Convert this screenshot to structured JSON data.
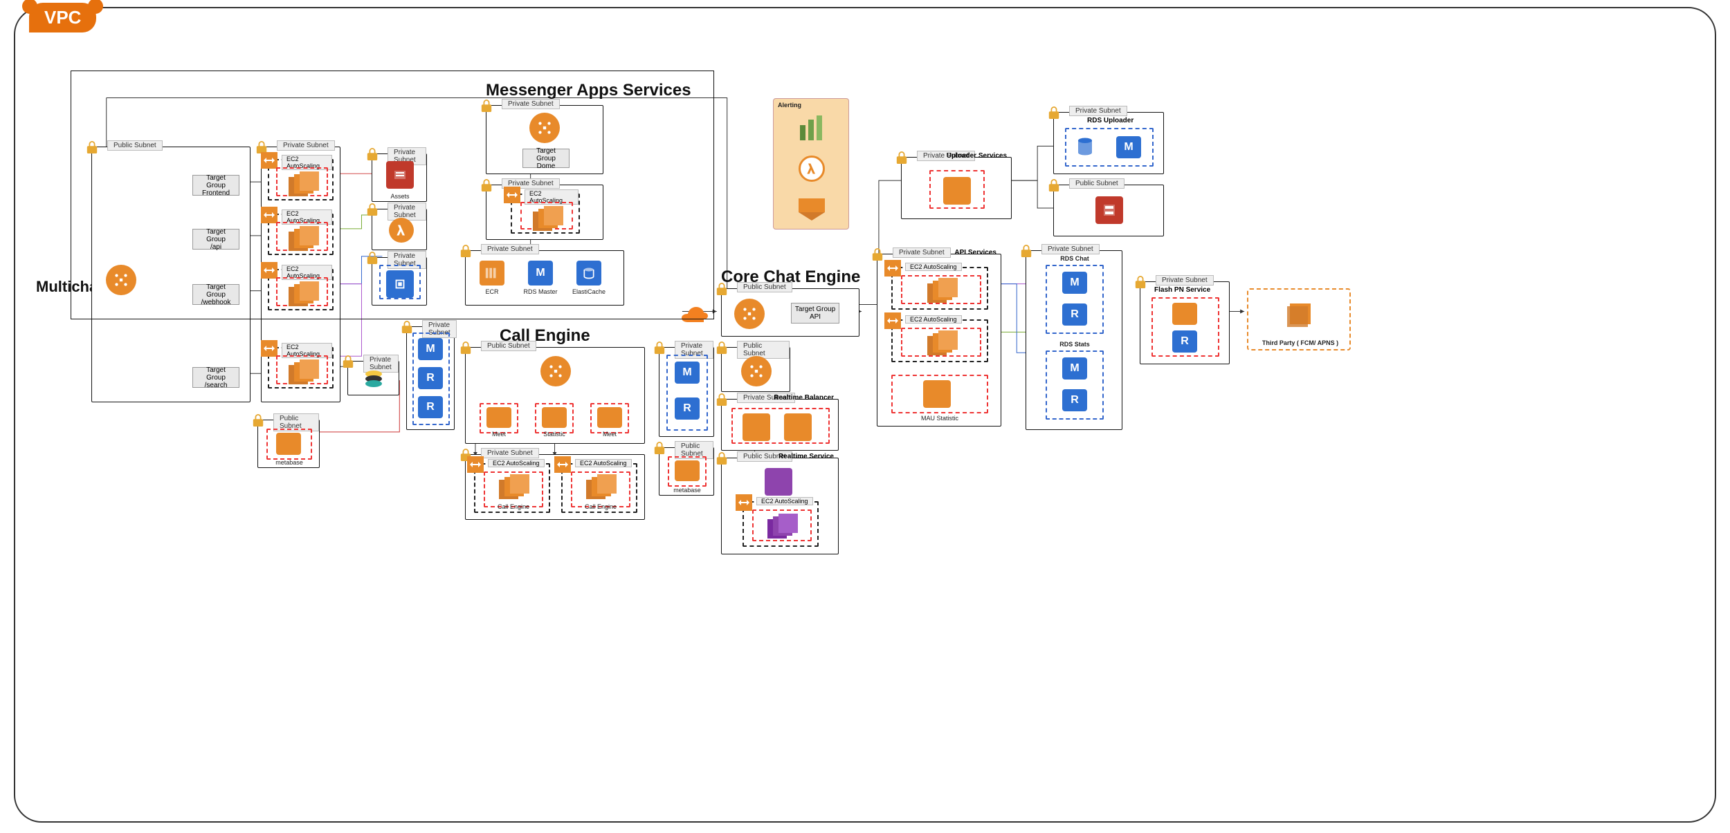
{
  "vpc_label": "VPC",
  "sections": {
    "multichannel": "Multichannel",
    "messenger": "Messenger Apps Services",
    "call_engine": "Call Engine",
    "core_chat": "Core Chat Engine"
  },
  "subnet_labels": {
    "public": "Public Subnet",
    "private": "Private Subnet"
  },
  "asg_label": "EC2 AutoScaling",
  "target_groups": {
    "frontend": "Target Group\nFrontend",
    "api": "Target Group\n/api",
    "webhook": "Target Group\n/webhook",
    "search": "Target Group\n/search",
    "dome": "Target Group\nDome",
    "core_api": "Target Group\nAPI"
  },
  "services": {
    "assets": "Assets",
    "metabase": "metabase",
    "ecr": "ECR",
    "rds_master": "RDS Master",
    "elasticache": "ElastiCache",
    "meet": "Meet",
    "statistic": "Statistic",
    "call_engine": "Call Engine",
    "realtime_balancer": "Realtime Balancer",
    "realtime_service": "Realtime Service",
    "api_services": "API Services",
    "mau_statistic": "MAU Statistic",
    "uploader_services": "Uploader Services",
    "rds_uploader": "RDS Uploader",
    "rds_chat": "RDS Chat",
    "rds_stats": "RDS Stats",
    "flash_pn": "Flash PN Service",
    "third_party": "Third Party ( FCM/ APNS )"
  },
  "alerting": {
    "title": "Alerting"
  },
  "icons": {
    "m": "M",
    "r": "R"
  }
}
